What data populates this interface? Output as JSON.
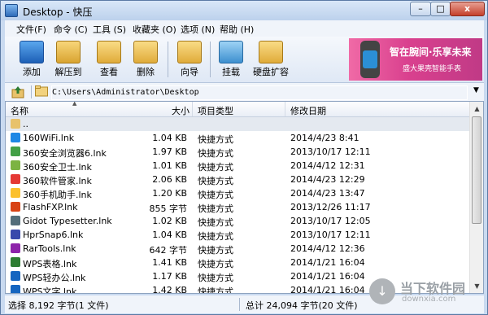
{
  "window": {
    "title": "Desktop - 快压",
    "min": "–",
    "max": "□",
    "close": "x"
  },
  "menu": [
    "文件(F)",
    "命令 (C)",
    "工具 (S)",
    "收藏夹 (O)",
    "选项 (N)",
    "帮助 (H)"
  ],
  "toolbar": {
    "add": "添加",
    "extract": "解压到",
    "view": "查看",
    "delete": "删除",
    "wizard": "向导",
    "mount": "挂载",
    "disk_expand": "硬盘扩容"
  },
  "banner": {
    "line1": "智在腕间·乐享未来",
    "line2": "盛大果壳智能手表"
  },
  "address": {
    "path": "C:\\Users\\Administrator\\Desktop",
    "dropdown": "▼"
  },
  "columns": {
    "name": "名称",
    "size": "大小",
    "type": "项目类型",
    "date": "修改日期"
  },
  "files": [
    {
      "name": "..",
      "size": "",
      "type": "",
      "date": "",
      "icon": "folder-up-icon",
      "color": "#e8c26b"
    },
    {
      "name": "160WiFi.lnk",
      "size": "1.04 KB",
      "type": "快捷方式",
      "date": "2014/4/23 8:41",
      "icon": "wifi-icon",
      "color": "#1e88e5"
    },
    {
      "name": "360安全浏览器6.lnk",
      "size": "1.97 KB",
      "type": "快捷方式",
      "date": "2013/10/17 12:11",
      "icon": "browser-icon",
      "color": "#43a047"
    },
    {
      "name": "360安全卫士.lnk",
      "size": "1.01 KB",
      "type": "快捷方式",
      "date": "2014/4/12 12:31",
      "icon": "shield-icon",
      "color": "#7cb342"
    },
    {
      "name": "360软件管家.lnk",
      "size": "2.06 KB",
      "type": "快捷方式",
      "date": "2014/4/23 12:29",
      "icon": "software-manager-icon",
      "color": "#e53935"
    },
    {
      "name": "360手机助手.lnk",
      "size": "1.20 KB",
      "type": "快捷方式",
      "date": "2014/4/23 13:47",
      "icon": "phone-assistant-icon",
      "color": "#fbc02d"
    },
    {
      "name": "FlashFXP.lnk",
      "size": "855 字节",
      "type": "快捷方式",
      "date": "2013/12/26 11:17",
      "icon": "ftp-icon",
      "color": "#d84315"
    },
    {
      "name": "Gidot Typesetter.lnk",
      "size": "1.02 KB",
      "type": "快捷方式",
      "date": "2013/10/17 12:05",
      "icon": "typesetter-icon",
      "color": "#546e7a"
    },
    {
      "name": "HprSnap6.lnk",
      "size": "1.04 KB",
      "type": "快捷方式",
      "date": "2013/10/17 12:11",
      "icon": "snapshot-icon",
      "color": "#3949ab"
    },
    {
      "name": "RarTools.lnk",
      "size": "642 字节",
      "type": "快捷方式",
      "date": "2014/4/12 12:36",
      "icon": "archive-icon",
      "color": "#8e24aa"
    },
    {
      "name": "WPS表格.lnk",
      "size": "1.41 KB",
      "type": "快捷方式",
      "date": "2014/1/21 16:04",
      "icon": "wps-spreadsheet-icon",
      "color": "#2e7d32"
    },
    {
      "name": "WPS轻办公.lnk",
      "size": "1.17 KB",
      "type": "快捷方式",
      "date": "2014/1/21 16:04",
      "icon": "wps-office-icon",
      "color": "#1565c0"
    },
    {
      "name": "WPS文字.lnk",
      "size": "1.42 KB",
      "type": "快捷方式",
      "date": "2014/1/21 16:04",
      "icon": "wps-writer-icon",
      "color": "#1565c0"
    }
  ],
  "status": {
    "selected": "选择 8,192 字节(1 文件)",
    "total": "总计 24,094 字节(20 文件)"
  },
  "watermark": {
    "t1": "当下软件园",
    "t2": "downxia.com"
  }
}
